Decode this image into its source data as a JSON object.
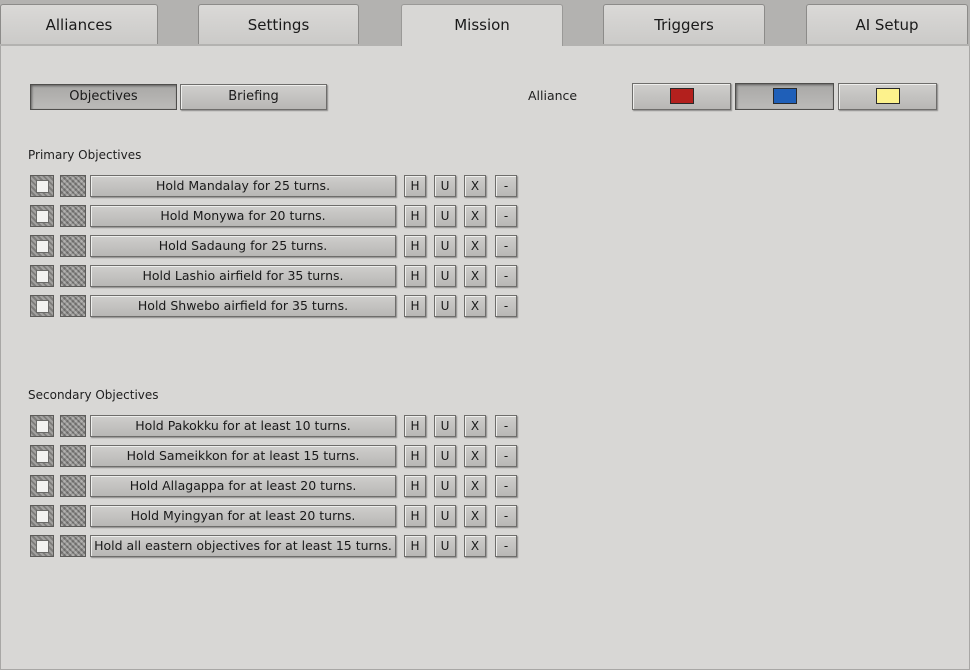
{
  "tabs": [
    {
      "label": "Alliances"
    },
    {
      "label": "Settings"
    },
    {
      "label": "Mission"
    },
    {
      "label": "Triggers"
    },
    {
      "label": "AI Setup"
    }
  ],
  "active_tab": "Mission",
  "subtabs": {
    "objectives": "Objectives",
    "briefing": "Briefing",
    "active": "Objectives"
  },
  "alliance": {
    "label": "Alliance",
    "colors": [
      "#b3201d",
      "#1f5fb8",
      "#fdf28c"
    ],
    "selected_index": 1
  },
  "row_buttons": {
    "h": "H",
    "u": "U",
    "x": "X",
    "minus": "-"
  },
  "primary": {
    "heading": "Primary Objectives",
    "items": [
      "Hold Mandalay for 25 turns.",
      "Hold Monywa for 20 turns.",
      "Hold Sadaung for 25 turns.",
      "Hold Lashio airfield for 35 turns.",
      "Hold Shwebo airfield for 35 turns."
    ]
  },
  "secondary": {
    "heading": "Secondary Objectives",
    "items": [
      "Hold Pakokku for at least 10 turns.",
      "Hold Sameikkon for at least 15 turns.",
      "Hold Allagappa for at least 20 turns.",
      "Hold Myingyan for at least 20 turns.",
      "Hold all eastern objectives for at least 15 turns."
    ]
  }
}
